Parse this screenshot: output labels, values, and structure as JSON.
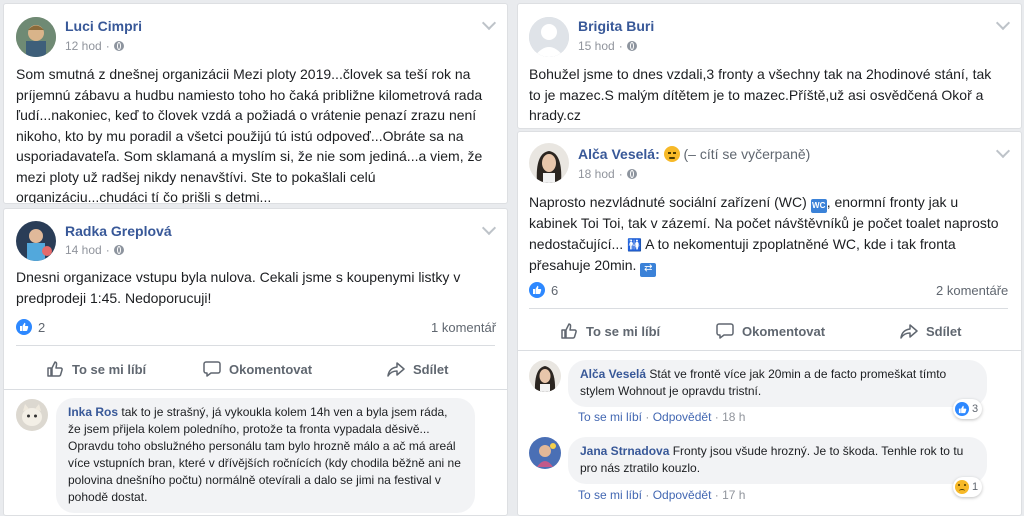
{
  "posts": {
    "luci": {
      "author": "Luci Cimpri",
      "time": "12 hod",
      "text": "Som smutná z dnešnej organizácii Mezi ploty 2019...človek sa teší rok na príjemnú zábavu a hudbu namiesto toho ho čaká približne kilometrová rada ľudí...nakoniec, keď to človek vzdá a požiadá o vrátenie penazí zrazu není nikoho, kto by mu poradil a všetci použijú tú istú odpoveď...Obráte sa na usporiadavateľa. Som sklamaná a myslím si, že nie som jediná...a viem, že mezi ploty už radšej nikdy nenavštívi. Ste to pokašlali celú organizáciu...chudáci tí čo prišli s detmi..."
    },
    "radka": {
      "author": "Radka Greplová",
      "time": "14 hod",
      "text": "Dnesni organizace vstupu byla nulova. Cekali jsme s koupenymi listky v predprodeji 1:45. Nedoporucuji!",
      "likes": "2",
      "comments": "1 komentář"
    },
    "brigita": {
      "author": "Brigita Buri",
      "time": "15 hod",
      "text": "Bohužel jsme to dnes vzdali,3 fronty a všechny tak na 2hodinové stání, tak to je mazec.S malým dítětem je to mazec.Příště,už asi osvědčená Okoř a hrady.cz"
    },
    "alca": {
      "author": "Alča Veselá",
      "feeling": "(– cítí se vyčerpaně)",
      "time": "18 hod",
      "text_1": "Naprosto nezvládnuté sociální zařízení (WC)",
      "text_2": ", enormní fronty jak u kabinek Toi Toi, tak v zázemí. Na počet návštěvníků je počet toalet naprosto nedostačující...",
      "text_3": "A to nekomentuji zpoplatněné WC, kde i tak fronta přesahuje 20min.",
      "likes": "6",
      "comments": "2 komentáře"
    }
  },
  "actions": {
    "like": "To se mi líbí",
    "comment": "Okomentovat",
    "share": "Sdílet"
  },
  "comments": {
    "inka": {
      "author": "Inka Ros",
      "text": "tak to je strašný, já vykoukla kolem 14h ven a byla jsem ráda, že jsem přijela kolem poledního, protože ta fronta vypadala děsivě... Opravdu toho obslužného personálu tam bylo hrozně málo a ač má areál více vstupních bran, které v dřívějších ročnících (kdy chodila běžně ani ne polovina dnešního počtu) normálně otevírali a dalo se jimi na festival v pohodě dostat."
    },
    "alca": {
      "author": "Alča Veselá",
      "text": "Stát ve frontě více jak 20min a de facto promeškat tímto stylem Wohnout je opravdu tristní.",
      "like": "To se mi líbí",
      "reply": "Odpovědět",
      "time": "18 h",
      "reactions": "3"
    },
    "jana": {
      "author": "Jana Strnadova",
      "text": "Fronty jsou všude hrozný. Je to škoda. Tenhle rok to tu pro nás ztratilo kouzlo.",
      "like": "To se mi líbí",
      "reply": "Odpovědět",
      "time": "17 h",
      "reactions": "1"
    }
  },
  "colors": {
    "name": "#385898",
    "meta": "#90949c",
    "like_blue": "#2d88ff",
    "bg": "#e9ebee"
  }
}
